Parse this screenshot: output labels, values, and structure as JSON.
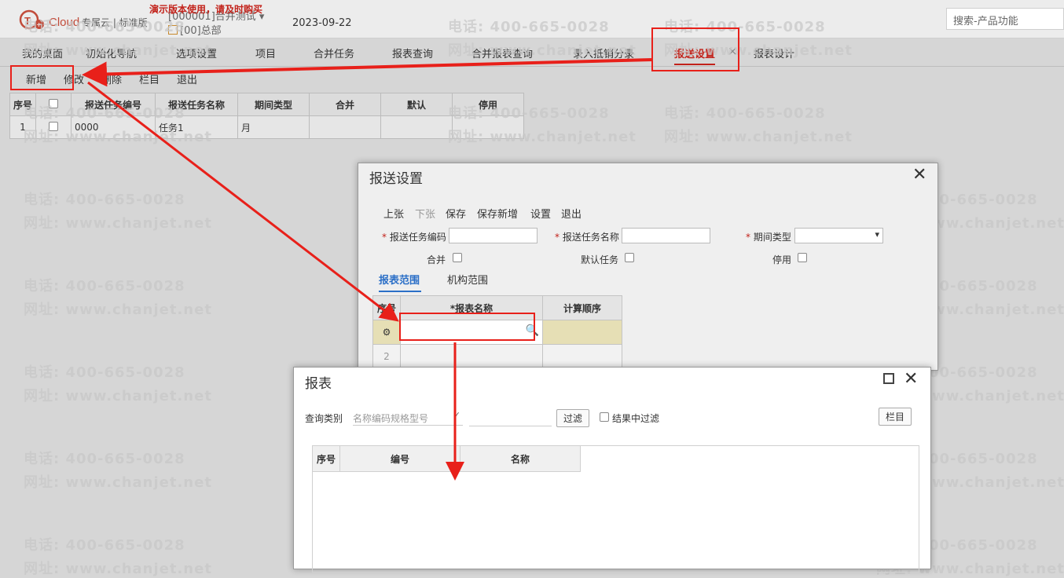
{
  "header": {
    "logo_text": "Cloud",
    "edition": "专属云 | 标准版",
    "demo_warning": "演示版本使用，请及时购买",
    "company": "[000001]合并测试",
    "org": "[00]总部",
    "date": "2023-09-22",
    "search_placeholder": "搜索-产品功能"
  },
  "nav": {
    "tabs": [
      "我的桌面",
      "初始化导航",
      "选项设置",
      "项目",
      "合并任务",
      "报表查询",
      "合并报表查询",
      "录入抵销分录",
      "报送设置",
      "报表设计"
    ],
    "active_tab": "报送设置",
    "close_glyph": "×"
  },
  "toolbar": {
    "add": "新增",
    "edit": "修改",
    "delete": "删除",
    "columns": "栏目",
    "exit": "退出"
  },
  "main_table": {
    "headers": [
      "序号",
      "",
      "报送任务编号",
      "报送任务名称",
      "期间类型",
      "合并",
      "默认",
      "停用"
    ],
    "rows": [
      {
        "seq": "1",
        "code": "0000",
        "name": "任务1",
        "period": "月"
      }
    ]
  },
  "dialog1": {
    "title": "报送设置",
    "toolbar": [
      "上张",
      "下张",
      "保存",
      "保存新增",
      "设置",
      "退出"
    ],
    "fields": {
      "task_code_label": "报送任务编码",
      "task_name_label": "报送任务名称",
      "period_type_label": "期间类型",
      "merge_label": "合并",
      "default_label": "默认任务",
      "disabled_label": "停用",
      "required_mark": "*"
    },
    "tabs": [
      "报表范围",
      "机构范围"
    ],
    "grid_headers": [
      "序号",
      "*报表名称",
      "计算顺序"
    ],
    "grid_rows": [
      "",
      "2"
    ]
  },
  "dialog2": {
    "title": "报表",
    "query_label": "查询类别",
    "query_placeholder": "名称编码规格型号",
    "filter_button": "过滤",
    "filter_in_result": "结果中过滤",
    "columns_button": "栏目",
    "grid_headers": [
      "序号",
      "编号",
      "名称"
    ]
  },
  "watermark": {
    "phone": "电话: 400-665-0028",
    "site": "网址: www.chanjet.net"
  },
  "colors": {
    "accent_red": "#c2221a",
    "annotation_red": "#e8201a",
    "row_highlight": "#e6dfb5"
  }
}
